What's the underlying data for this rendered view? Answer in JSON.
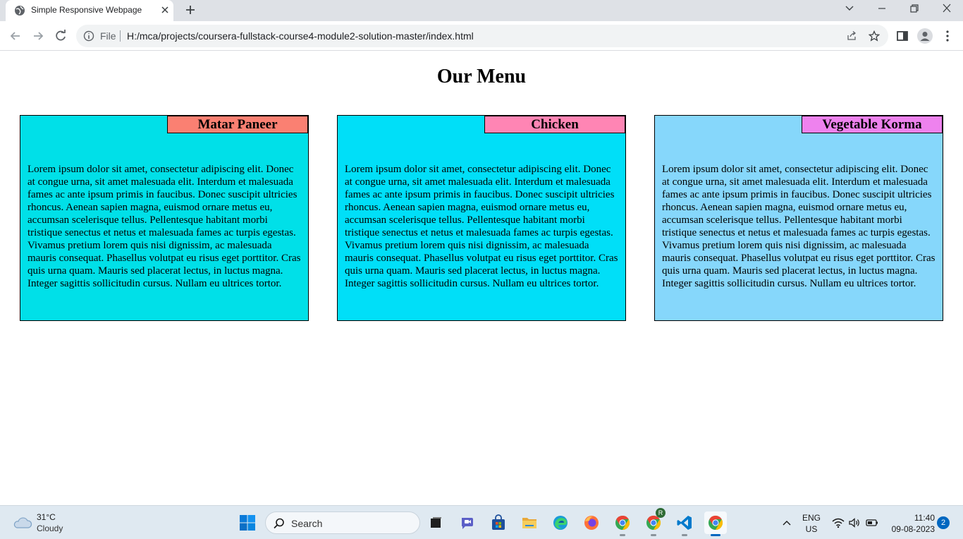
{
  "browser": {
    "tab_title": "Simple Responsive Webpage",
    "omnibox": {
      "scheme_label": "File",
      "url": "H:/mca/projects/coursera-fullstack-course4-module2-solution-master/index.html"
    }
  },
  "page": {
    "title": "Our Menu",
    "cards": [
      {
        "label": "Matar Paneer",
        "label_color": "#fa8072",
        "background": "#00e0e8",
        "text": "Lorem ipsum dolor sit amet, consectetur adipiscing elit. Donec at congue urna, sit amet malesuada elit. Interdum et malesuada fames ac ante ipsum primis in faucibus. Donec suscipit ultricies rhoncus. Aenean sapien magna, euismod ornare metus eu, accumsan scelerisque tellus. Pellentesque habitant morbi tristique senectus et netus et malesuada fames ac turpis egestas. Vivamus pretium lorem quis nisi dignissim, ac malesuada mauris consequat. Phasellus volutpat eu risus eget porttitor. Cras quis urna quam. Mauris sed placerat lectus, in luctus magna. Integer sagittis sollicitudin cursus. Nullam eu ultrices tortor."
      },
      {
        "label": "Chicken",
        "label_color": "#ff85b4",
        "background": "#00dff8",
        "text": "Lorem ipsum dolor sit amet, consectetur adipiscing elit. Donec at congue urna, sit amet malesuada elit. Interdum et malesuada fames ac ante ipsum primis in faucibus. Donec suscipit ultricies rhoncus. Aenean sapien magna, euismod ornare metus eu, accumsan scelerisque tellus. Pellentesque habitant morbi tristique senectus et netus et malesuada fames ac turpis egestas. Vivamus pretium lorem quis nisi dignissim, ac malesuada mauris consequat. Phasellus volutpat eu risus eget porttitor. Cras quis urna quam. Mauris sed placerat lectus, in luctus magna. Integer sagittis sollicitudin cursus. Nullam eu ultrices tortor."
      },
      {
        "label": "Vegetable Korma",
        "label_color": "#ee82ee",
        "background": "#86d7fb",
        "text": "Lorem ipsum dolor sit amet, consectetur adipiscing elit. Donec at congue urna, sit amet malesuada elit. Interdum et malesuada fames ac ante ipsum primis in faucibus. Donec suscipit ultricies rhoncus. Aenean sapien magna, euismod ornare metus eu, accumsan scelerisque tellus. Pellentesque habitant morbi tristique senectus et netus et malesuada fames ac turpis egestas. Vivamus pretium lorem quis nisi dignissim, ac malesuada mauris consequat. Phasellus volutpat eu risus eget porttitor. Cras quis urna quam. Mauris sed placerat lectus, in luctus magna. Integer sagittis sollicitudin cursus. Nullam eu ultrices tortor."
      }
    ]
  },
  "taskbar": {
    "weather": {
      "temp": "31°C",
      "condition": "Cloudy"
    },
    "search_label": "Search",
    "apps": [
      {
        "name": "task-view",
        "color": "#1f1f1f"
      },
      {
        "name": "meet",
        "color": "#5b5fc7"
      },
      {
        "name": "store",
        "color": "#1e4f9c"
      },
      {
        "name": "file-explorer",
        "color": "#f2c14e"
      },
      {
        "name": "edge",
        "color": "#1a9bd7"
      },
      {
        "name": "firefox",
        "color": "#ff7139"
      },
      {
        "name": "chrome",
        "color": "#34a853"
      },
      {
        "name": "chrome-profile",
        "color": "#34a853"
      },
      {
        "name": "vscode",
        "color": "#007acc"
      },
      {
        "name": "chrome-active",
        "color": "#34a853"
      }
    ],
    "profile_badge": "R",
    "language": {
      "line1": "ENG",
      "line2": "US"
    },
    "clock": {
      "time": "11:40",
      "date": "09-08-2023"
    },
    "notification_count": "2"
  }
}
